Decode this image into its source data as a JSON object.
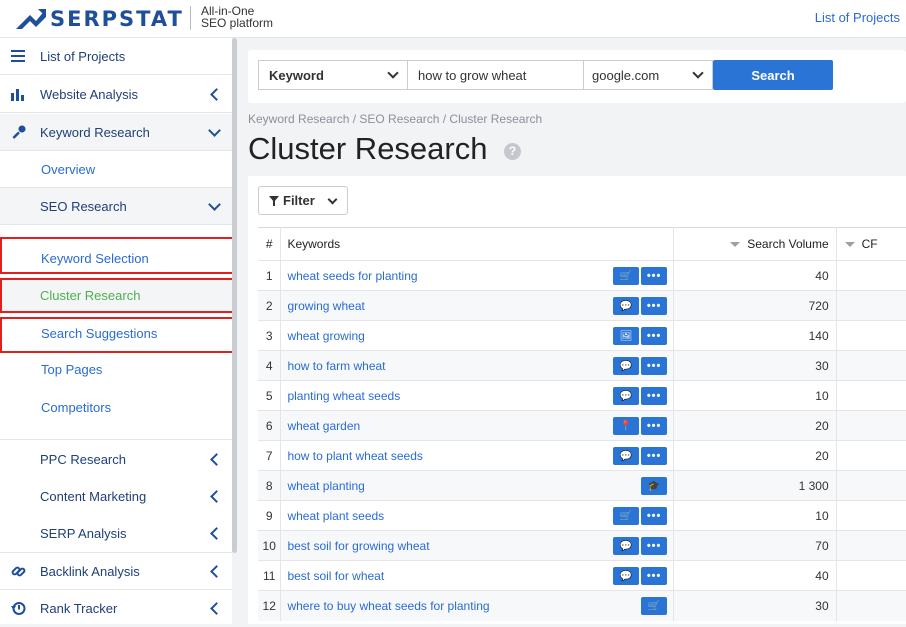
{
  "header": {
    "brand": "SERPSTAT",
    "tagline_line1": "All-in-One",
    "tagline_line2": "SEO platform",
    "projects_link": "List of Projects"
  },
  "sidebar": {
    "list_of_projects": "List of Projects",
    "website_analysis": "Website Analysis",
    "keyword_research": "Keyword Research",
    "overview": "Overview",
    "seo_research": "SEO Research",
    "keyword_selection": "Keyword Selection",
    "cluster_research": "Cluster Research",
    "search_suggestions": "Search Suggestions",
    "top_pages": "Top Pages",
    "competitors": "Competitors",
    "ppc_research": "PPC Research",
    "content_marketing": "Content Marketing",
    "serp_analysis": "SERP Analysis",
    "backlink_analysis": "Backlink Analysis",
    "rank_tracker": "Rank Tracker"
  },
  "search": {
    "type_value": "Keyword",
    "query_value": "how to grow wheat",
    "database_value": "google.com",
    "button_label": "Search"
  },
  "breadcrumb": "Keyword Research / SEO Research / Cluster Research",
  "page_title": "Cluster Research",
  "help_glyph": "?",
  "filter_label": "Filter",
  "table": {
    "headers": {
      "num": "#",
      "keywords": "Keywords",
      "volume": "Search Volume",
      "cpc": "CF"
    },
    "rows": [
      {
        "num": "1",
        "keyword": "wheat seeds for planting",
        "volume": "40",
        "icon": "cart-icon",
        "glyph": "🛒",
        "more": true
      },
      {
        "num": "2",
        "keyword": "growing wheat",
        "volume": "720",
        "icon": "chat-icon",
        "glyph": "💬",
        "more": true
      },
      {
        "num": "3",
        "keyword": "wheat growing",
        "volume": "140",
        "icon": "carousel-icon",
        "glyph": "🖼",
        "more": true
      },
      {
        "num": "4",
        "keyword": "how to farm wheat",
        "volume": "30",
        "icon": "chat-icon",
        "glyph": "💬",
        "more": true
      },
      {
        "num": "5",
        "keyword": "planting wheat seeds",
        "volume": "10",
        "icon": "chat-icon",
        "glyph": "💬",
        "more": true
      },
      {
        "num": "6",
        "keyword": "wheat garden",
        "volume": "20",
        "icon": "map-pin-icon",
        "glyph": "📍",
        "more": true
      },
      {
        "num": "7",
        "keyword": "how to plant wheat seeds",
        "volume": "20",
        "icon": "chat-icon",
        "glyph": "💬",
        "more": true
      },
      {
        "num": "8",
        "keyword": "wheat planting",
        "volume": "1 300",
        "icon": "graduation-cap-icon",
        "glyph": "🎓",
        "more": false
      },
      {
        "num": "9",
        "keyword": "wheat plant seeds",
        "volume": "10",
        "icon": "cart-icon",
        "glyph": "🛒",
        "more": true
      },
      {
        "num": "10",
        "keyword": "best soil for growing wheat",
        "volume": "70",
        "icon": "chat-icon",
        "glyph": "💬",
        "more": true
      },
      {
        "num": "11",
        "keyword": "best soil for wheat",
        "volume": "40",
        "icon": "chat-icon",
        "glyph": "💬",
        "more": true
      },
      {
        "num": "12",
        "keyword": "where to buy wheat seeds for planting",
        "volume": "30",
        "icon": "cart-icon",
        "glyph": "🛒",
        "more": false
      }
    ]
  },
  "colors": {
    "brand": "#1f4f9a",
    "link": "#2a6bd5",
    "active": "#4cb04f",
    "highlight_box": "#e01f1f",
    "button": "#2a74d6"
  }
}
